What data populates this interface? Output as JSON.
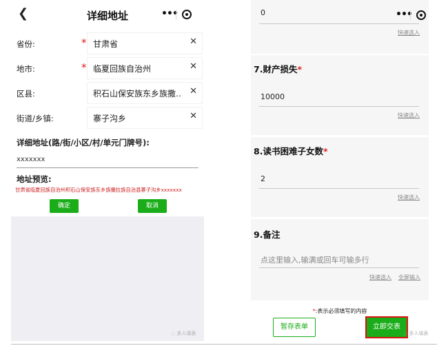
{
  "left": {
    "title": "详细地址",
    "fields": [
      {
        "label": "省份:",
        "required": true,
        "value": "甘肃省"
      },
      {
        "label": "地市:",
        "required": true,
        "value": "临夏回族自治州"
      },
      {
        "label": "区县:",
        "required": false,
        "value": "积石山保安族东乡族撒…"
      },
      {
        "label": "街道/乡镇:",
        "required": false,
        "value": "寨子沟乡"
      }
    ],
    "detail_label": "详细地址(路/街/小区/村/单元门牌号):",
    "detail_value": "xxxxxxx",
    "preview_label": "地址预览:",
    "preview_value": "甘肃省临夏回族自治州积石山保安族东乡族撒拉族自治县寨子沟乡xxxxxxx",
    "confirm_label": "确定",
    "cancel_label": "取消",
    "watermark": "多人填表"
  },
  "right": {
    "top_answer": "0",
    "q7": {
      "title": "7.财产损失",
      "answer": "10000"
    },
    "q8": {
      "title": "8.读书困难子女数",
      "answer": "2"
    },
    "q9": {
      "title": "9.备注",
      "placeholder": "点这里输入,输满或回车可输多行",
      "fullscreen_link": "全屏输入"
    },
    "quick_select": "快速选入",
    "required_star": "*",
    "footer_note": ":表示必须填写的内容",
    "save_label": "暂存表单",
    "submit_label": "立即交表",
    "watermark": "多人填表"
  },
  "icons": {
    "back": "chevron-left-icon",
    "more": "more-dots-icon",
    "close": "target-circle-icon",
    "clear": "close-icon"
  },
  "colors": {
    "accent_green": "#1aad19",
    "required_red": "#e02020",
    "highlight_border": "#dd1111"
  }
}
